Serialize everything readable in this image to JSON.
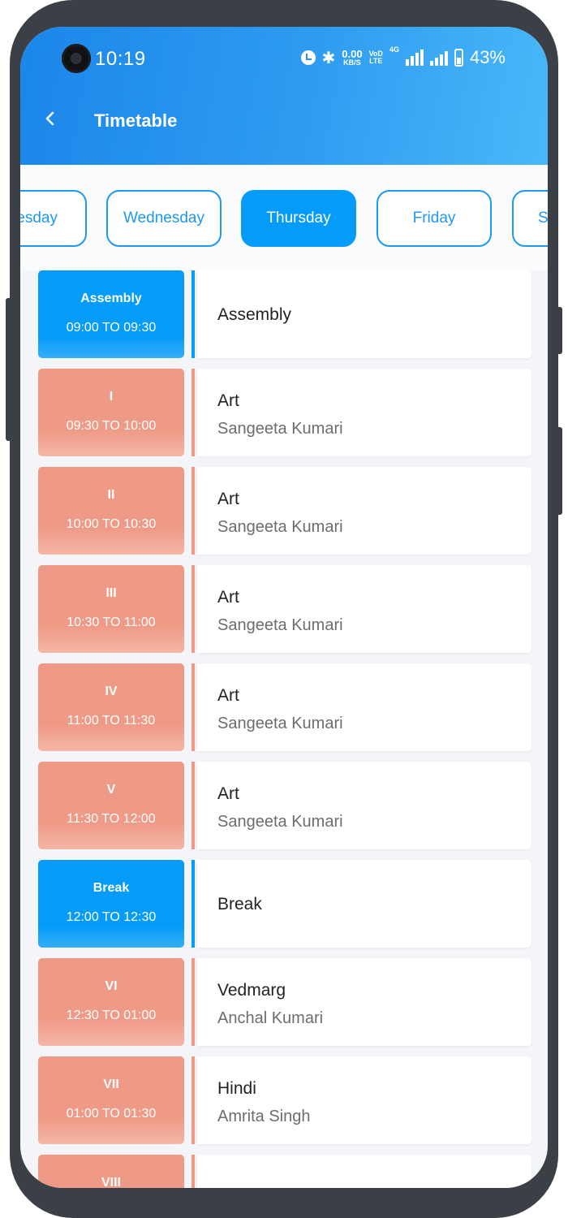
{
  "status_bar": {
    "time": "10:19",
    "net_speed": "0.00",
    "net_unit": "KB/S",
    "volte_top": "VoD",
    "volte_bottom": "LTE",
    "net_type": "4G",
    "battery": "43%"
  },
  "header": {
    "title": "Timetable",
    "back_icon": "chevron-left-icon"
  },
  "days": [
    {
      "label": "esday"
    },
    {
      "label": "Wednesday"
    },
    {
      "label": "Thursday",
      "active": true
    },
    {
      "label": "Friday"
    },
    {
      "label": "S"
    }
  ],
  "periods": [
    {
      "label": "Assembly",
      "time": "09:00 TO 09:30",
      "subject": "Assembly",
      "teacher": "",
      "color": "#049cf8"
    },
    {
      "label": "I",
      "time": "09:30 TO 10:00",
      "subject": "Art",
      "teacher": "Sangeeta Kumari",
      "color": "#ef9a86"
    },
    {
      "label": "II",
      "time": "10:00 TO 10:30",
      "subject": "Art",
      "teacher": "Sangeeta Kumari",
      "color": "#ef9a86"
    },
    {
      "label": "III",
      "time": "10:30 TO 11:00",
      "subject": "Art",
      "teacher": "Sangeeta Kumari",
      "color": "#ef9a86"
    },
    {
      "label": "IV",
      "time": "11:00 TO 11:30",
      "subject": "Art",
      "teacher": "Sangeeta Kumari",
      "color": "#ef9a86"
    },
    {
      "label": "V",
      "time": "11:30 TO 12:00",
      "subject": "Art",
      "teacher": "Sangeeta Kumari",
      "color": "#ef9a86"
    },
    {
      "label": "Break",
      "time": "12:00 TO 12:30",
      "subject": "Break",
      "teacher": "",
      "color": "#049cf8"
    },
    {
      "label": "VI",
      "time": "12:30 TO 01:00",
      "subject": "Vedmarg",
      "teacher": "Anchal Kumari",
      "color": "#ef9a86"
    },
    {
      "label": "VII",
      "time": "01:00 TO 01:30",
      "subject": "Hindi",
      "teacher": "Amrita Singh",
      "color": "#ef9a86"
    },
    {
      "label": "VIII",
      "time": "",
      "subject": "",
      "teacher": "",
      "color": "#ef9a86"
    }
  ],
  "colors": {
    "accent": "#049cf8",
    "period": "#ef9a86",
    "header_start": "#1b86ea",
    "header_end": "#49b8f8"
  }
}
